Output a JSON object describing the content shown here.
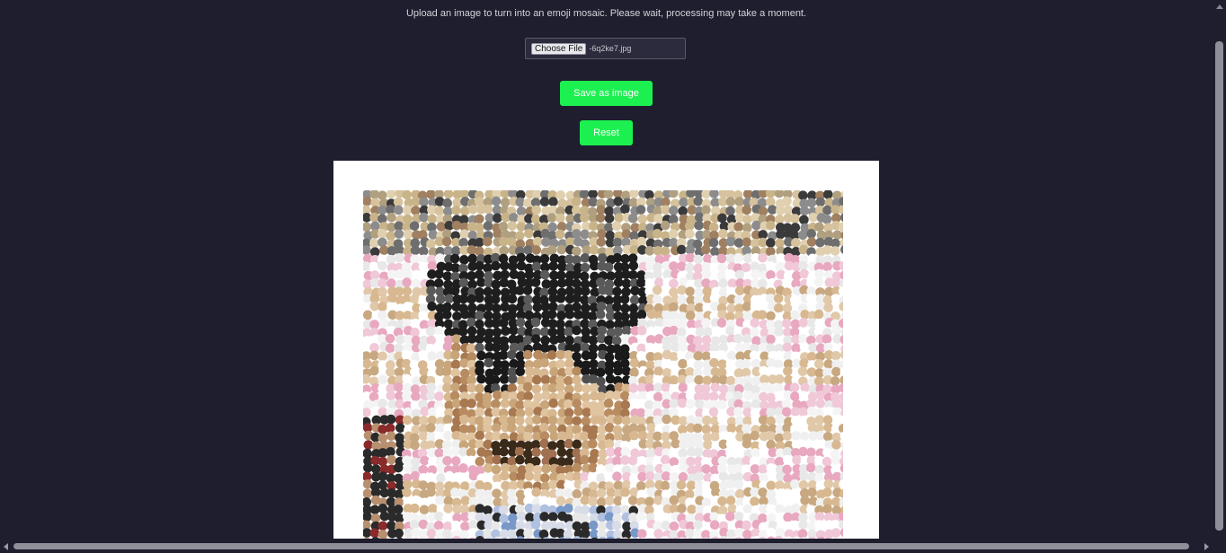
{
  "intro": {
    "text": "Upload an image to turn into an emoji mosaic. Please wait, processing may take a moment."
  },
  "file_input": {
    "button_label": "Choose File",
    "file_name": "-6q2ke7.jpg"
  },
  "buttons": {
    "save_label": "Save as image",
    "reset_label": "Reset"
  },
  "colors": {
    "page_background": "#1e1e2e",
    "button_accent": "#1cf050",
    "canvas_background": "#ffffff"
  },
  "mosaic": {
    "description_icon": "emoji-mosaic-image"
  }
}
